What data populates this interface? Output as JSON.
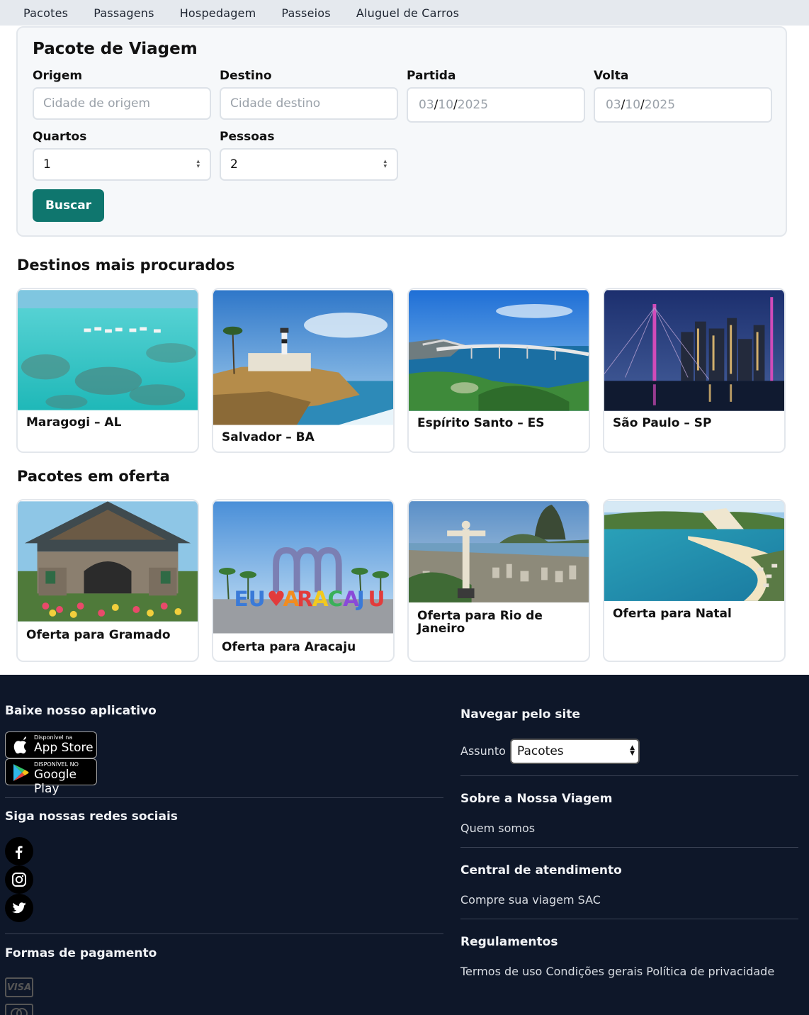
{
  "nav": {
    "items": [
      "Pacotes",
      "Passagens",
      "Hospedagem",
      "Passeios",
      "Aluguel de Carros"
    ]
  },
  "search": {
    "title": "Pacote de Viagem",
    "origin_label": "Origem",
    "origin_placeholder": "Cidade de origem",
    "dest_label": "Destino",
    "dest_placeholder": "Cidade destino",
    "depart_label": "Partida",
    "depart_value": {
      "day": "03",
      "month": "10",
      "year": "2025"
    },
    "return_label": "Volta",
    "return_value": {
      "day": "03",
      "month": "10",
      "year": "2025"
    },
    "rooms_label": "Quartos",
    "rooms_value": "1",
    "people_label": "Pessoas",
    "people_value": "2",
    "button_label": "Buscar"
  },
  "destinations": {
    "title": "Destinos mais procurados",
    "items": [
      {
        "label": "Maragogi – AL"
      },
      {
        "label": "Salvador – BA"
      },
      {
        "label": "Espírito Santo – ES"
      },
      {
        "label": "São Paulo – SP"
      }
    ]
  },
  "offers": {
    "title": "Pacotes em oferta",
    "items": [
      {
        "label": "Oferta para Gramado"
      },
      {
        "label": "Oferta para Aracaju"
      },
      {
        "label": "Oferta para Rio de Janeiro"
      },
      {
        "label": "Oferta para Natal"
      }
    ]
  },
  "footer": {
    "app_title": "Baixe nosso aplicativo",
    "appstore_small": "Disponível na",
    "appstore_big": "App Store",
    "googleplay_small": "DISPONÍVEL NO",
    "googleplay_big": "Google Play",
    "social_title": "Siga nossas redes sociais",
    "social_icons": [
      "facebook-icon",
      "instagram-icon",
      "twitter-icon"
    ],
    "payment_title": "Formas de pagamento",
    "payment_icons": [
      "visa-icon",
      "mastercard-icon"
    ],
    "visa_text": "VISA",
    "nav_title": "Navegar pelo site",
    "subject_label": "Assunto",
    "subject_value": "Pacotes",
    "about_title": "Sobre a Nossa Viagem",
    "about_link": "Quem somos",
    "support_title": "Central de atendimento",
    "support_link": "Compre sua viagem SAC",
    "rules_title": "Regulamentos",
    "rules_links": [
      "Termos de uso",
      "Condições gerais",
      "Política de privacidade"
    ]
  },
  "colors": {
    "nav_bg": "#e5e9ee",
    "accent": "#0f766e",
    "footer_bg": "#0e1729"
  }
}
